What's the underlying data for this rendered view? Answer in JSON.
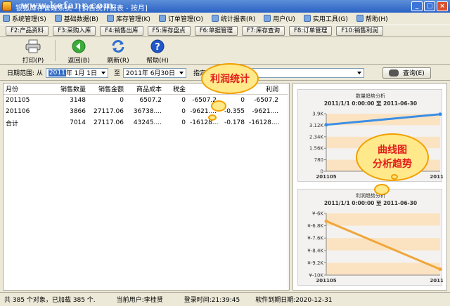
{
  "window": {
    "title": "银狐库存管理系统 - [销售统计报表 - 按月]",
    "watermark": "www.kefanr.com",
    "minimize": "_",
    "maximize": "□",
    "close": "×"
  },
  "menu": [
    "系统管理(S)",
    "基础数据(B)",
    "库存管理(K)",
    "订单管理(O)",
    "统计报表(R)",
    "用户(U)",
    "实用工具(G)",
    "帮助(H)"
  ],
  "fkeys": [
    "F2:产品资料",
    "F3:采购入库",
    "F4:销售出库",
    "F5:库存盘点",
    "F6:单据管理",
    "F7:库存查询",
    "F8:订单管理",
    "F10:销售利润"
  ],
  "toolbar": {
    "print": "打印(P)",
    "back": "返回(B)",
    "refresh": "刷新(R)",
    "help": "帮助(H)"
  },
  "filter": {
    "range_label": "日期范围: 从",
    "from_year": "2011",
    "from_rest": "年  1月  1日",
    "to_label": "至",
    "to_date": "2011年  6月30日",
    "product_label": "指定商品:",
    "product_value": "",
    "query": "查询(E)"
  },
  "table": {
    "headers": [
      "月份",
      "销售数量",
      "销售金额",
      "商品成本",
      "税金",
      "",
      "",
      "利润"
    ],
    "rows": [
      [
        "201105",
        "3148",
        "0",
        "6507.2",
        "0",
        "-6507.2",
        "0",
        "-6507.2"
      ],
      [
        "201106",
        "3866",
        "27117.06",
        "36738....",
        "0",
        "-9621....",
        "-0.355",
        "-9621...."
      ],
      [
        "合计",
        "7014",
        "27117.06",
        "43245....",
        "0",
        "-16128....",
        "-0.178",
        "-16128...."
      ]
    ]
  },
  "callouts": {
    "profit": "利润统计",
    "trend_line1": "曲线图",
    "trend_line2": "分析趋势"
  },
  "colors": {
    "line1": "#3a8ee6",
    "line2": "#f0a63a",
    "band": "#fbe3c2",
    "callout_text": "#e31b1b",
    "callout_fill": "#ffe98a"
  },
  "chart_data": [
    {
      "type": "line",
      "title": "数量趋势分析",
      "subtitle": "2011/1/1 0:00:00 至 2011-06-30",
      "x": [
        "201105",
        "201106"
      ],
      "xtick_labels": [
        "201105",
        "201106"
      ],
      "ytick_labels": [
        "3.9K",
        "3.12K",
        "2.34K",
        "1.56K",
        "780",
        "0"
      ],
      "ylim": [
        0,
        3900
      ],
      "series": [
        {
          "values": [
            3148,
            3866
          ]
        }
      ]
    },
    {
      "type": "line",
      "title": "利润趋势分析",
      "subtitle": "2011/1/1 0:00:00 至 2011-06-30",
      "x": [
        "201105",
        "201106"
      ],
      "xtick_labels": [
        "201105",
        "201106"
      ],
      "ytick_labels": [
        "¥-6K",
        "¥-6.8K",
        "¥-7.6K",
        "¥-8.4K",
        "¥-9.2K",
        "¥-10K"
      ],
      "ylim": [
        -10000,
        -6000
      ],
      "series": [
        {
          "values": [
            -6507.2,
            -9621
          ]
        }
      ]
    }
  ],
  "status": {
    "count": "共 385 个对象，已加载 385 个.",
    "user": "当前用户:李桂贤",
    "login": "登录时间:21:39:45",
    "expiry": "软件到期日期:2020-12-31"
  }
}
